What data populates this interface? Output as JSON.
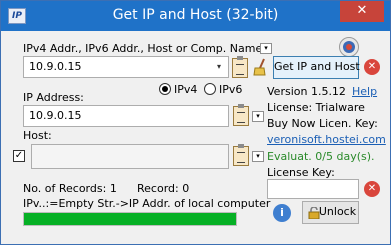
{
  "window": {
    "title": "Get IP and Host (32-bit)",
    "icon_text": "IP",
    "close_glyph": "✕"
  },
  "query": {
    "label": "IPv4 Addr., IPv6 Addr., Host or Comp. Name:",
    "value": "10.9.0.15",
    "button_label": "Get IP and Host"
  },
  "ip_version": {
    "ipv4_label": "IPv4",
    "ipv6_label": "IPv6",
    "selected": "IPv4"
  },
  "ip_address": {
    "label": "IP Address:",
    "value": "10.9.0.15"
  },
  "host": {
    "label": "Host:",
    "value": "",
    "checked": true
  },
  "stats": {
    "records_label": "No. of Records:",
    "records_value": "1",
    "record_label": "Record:",
    "record_value": "0",
    "hint": "IPv..:=Empty Str.->IP Addr. of local computer",
    "progress": 1.0
  },
  "info": {
    "version": "Version 1.5.12",
    "help": "Help",
    "license": "License: Trialware",
    "buy": "Buy Now Licen. Key:",
    "website": "veronisoft.hostei.com",
    "evaluation": "Evaluat. 0/5 day(s).",
    "key_label": "License Key:",
    "key_value": "",
    "unlock_label": "Unlock",
    "info_glyph": "i"
  },
  "colors": {
    "titlebar": "#1f72c8",
    "close": "#c7443a",
    "progress": "#06b025",
    "link": "#1b5fb5",
    "evaluation": "#2a8a2a"
  },
  "icons": {
    "drop": "▾",
    "xmark": "✕",
    "check": "✓"
  }
}
